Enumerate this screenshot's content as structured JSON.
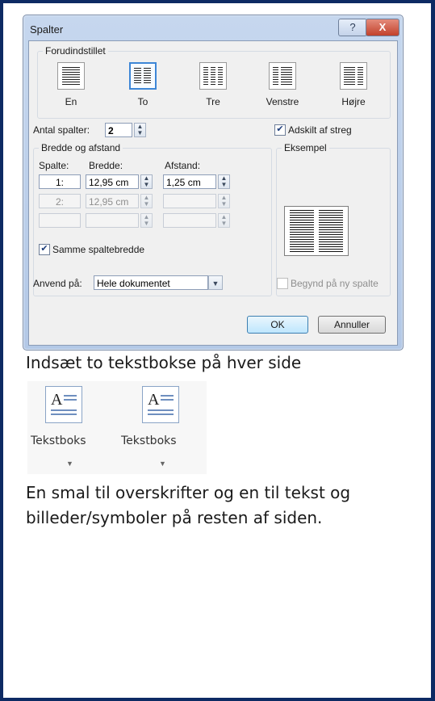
{
  "dialog": {
    "title": "Spalter",
    "help_label": "?",
    "close_label": "X",
    "presets": {
      "group_label": "Forudindstillet",
      "items": [
        "En",
        "To",
        "Tre",
        "Venstre",
        "Højre"
      ],
      "selected": "To"
    },
    "antal_label": "Antal spalter:",
    "antal_value": "2",
    "adskilt_label": "Adskilt af streg",
    "adskilt_checked": true,
    "bredde_group_label": "Bredde og afstand",
    "col_headers": {
      "spalte": "Spalte:",
      "bredde": "Bredde:",
      "afstand": "Afstand:"
    },
    "rows": [
      {
        "num": "1:",
        "bredde": "12,95 cm",
        "afstand": "1,25 cm"
      },
      {
        "num": "2:",
        "bredde": "12,95 cm",
        "afstand": ""
      },
      {
        "num": "",
        "bredde": "",
        "afstand": ""
      }
    ],
    "samme_label": "Samme spaltebredde",
    "samme_checked": true,
    "eksempel_label": "Eksempel",
    "anvend_label": "Anvend på:",
    "anvend_value": "Hele dokumentet",
    "begynd_label": "Begynd på ny spalte",
    "begynd_checked": false,
    "ok_label": "OK",
    "cancel_label": "Annuller"
  },
  "content": {
    "line1": "Indsæt to tekstbokse på hver side",
    "textbox_buttons": [
      "Tekstboks",
      "Tekstboks"
    ],
    "paragraph": "En smal til overskrifter og en til tekst og billeder/symboler på resten af siden."
  }
}
